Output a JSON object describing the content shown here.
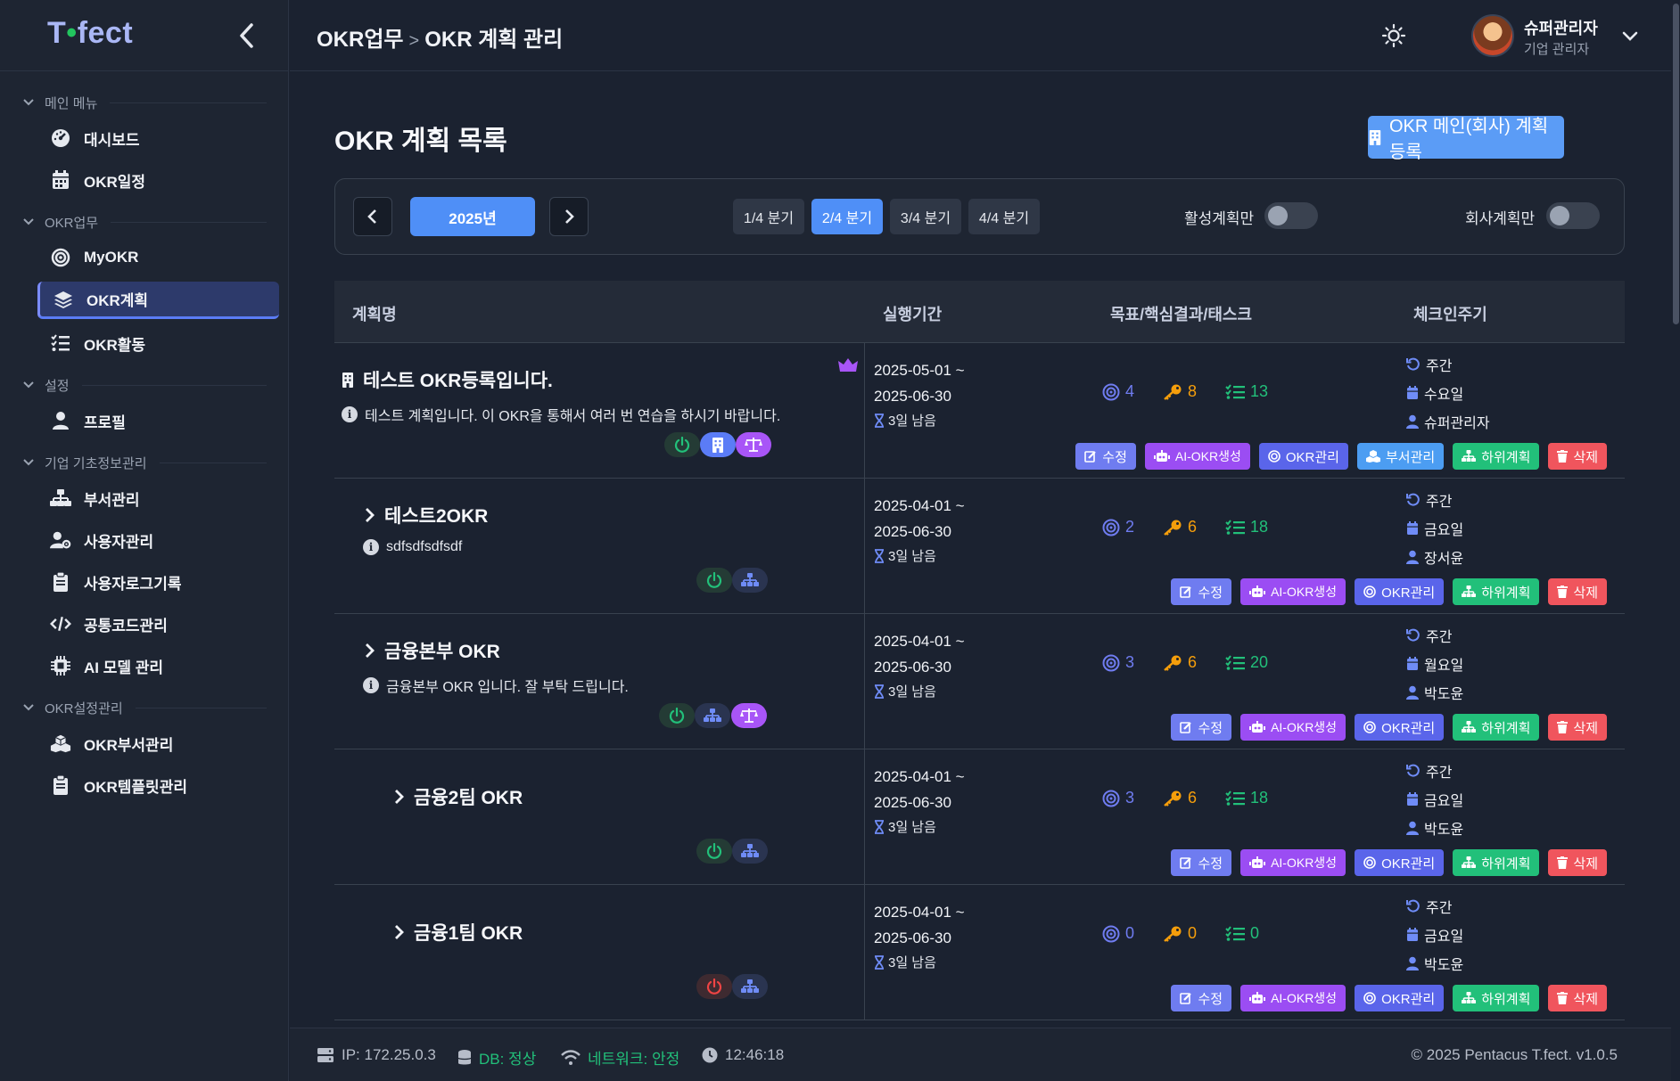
{
  "app": {
    "logo_text_pre": "T",
    "logo_text_post": "fect"
  },
  "sidebar": {
    "sections": [
      {
        "label": "메인 메뉴",
        "items": [
          {
            "label": "대시보드",
            "icon": "gauge-icon"
          },
          {
            "label": "OKR일정",
            "icon": "calendar-icon"
          }
        ]
      },
      {
        "label": "OKR업무",
        "items": [
          {
            "label": "MyOKR",
            "icon": "target-icon"
          },
          {
            "label": "OKR계획",
            "icon": "layers-icon",
            "active": true
          },
          {
            "label": "OKR활동",
            "icon": "list-check-icon"
          }
        ]
      },
      {
        "label": "설정",
        "items": [
          {
            "label": "프로필",
            "icon": "user-icon"
          }
        ]
      },
      {
        "label": "기업 기초정보관리",
        "items": [
          {
            "label": "부서관리",
            "icon": "sitemap-icon"
          },
          {
            "label": "사용자관리",
            "icon": "user-gear-icon"
          },
          {
            "label": "사용자로그기록",
            "icon": "clipboard-icon"
          },
          {
            "label": "공통코드관리",
            "icon": "code-icon"
          },
          {
            "label": "AI 모델 관리",
            "icon": "chip-icon"
          }
        ]
      },
      {
        "label": "OKR설정관리",
        "items": [
          {
            "label": "OKR부서관리",
            "icon": "cubes-icon"
          },
          {
            "label": "OKR템플릿관리",
            "icon": "clipboard-icon"
          }
        ]
      }
    ]
  },
  "header": {
    "breadcrumb_parent": "OKR업무",
    "breadcrumb_sep": ">",
    "breadcrumb_current": "OKR 계획 관리",
    "user_name": "슈퍼관리자",
    "user_role": "기업 관리자"
  },
  "page": {
    "title": "OKR 계획 목록",
    "register_button": "OKR 메인(회사) 계획 등록"
  },
  "filter": {
    "year": "2025년",
    "quarters": [
      "1/4 분기",
      "2/4 분기",
      "3/4 분기",
      "4/4 분기"
    ],
    "active_quarter": "2/4 분기",
    "toggle_active_label": "활성계획만",
    "toggle_company_label": "회사계획만"
  },
  "table": {
    "headers": [
      "계획명",
      "실행기간",
      "목표/핵심결과/태스크",
      "체크인주기"
    ],
    "action_labels": {
      "edit": "수정",
      "ai": "AI-OKR생성",
      "okr": "OKR관리",
      "dept": "부서관리",
      "sub": "하위계획",
      "del": "삭제"
    },
    "rows": [
      {
        "name": "테스트 OKR등록입니다.",
        "desc": "테스트 계획입니다. 이 OKR을 통해서 여러 번 연습을 하시기 바랍니다.",
        "start": "2025-05-01 ~",
        "end": "2025-06-30",
        "remain": "3일 남음",
        "objectives": "4",
        "key_results": "8",
        "tasks": "13",
        "cycle": "주간",
        "day": "수요일",
        "owner": "슈퍼관리자"
      },
      {
        "name": "테스트2OKR",
        "desc": "sdfsdfsdfsdf",
        "start": "2025-04-01 ~",
        "end": "2025-06-30",
        "remain": "3일 남음",
        "objectives": "2",
        "key_results": "6",
        "tasks": "18",
        "cycle": "주간",
        "day": "금요일",
        "owner": "장서윤"
      },
      {
        "name": "금융본부 OKR",
        "desc": "금융본부 OKR 입니다. 잘 부탁 드립니다.",
        "start": "2025-04-01 ~",
        "end": "2025-06-30",
        "remain": "3일 남음",
        "objectives": "3",
        "key_results": "6",
        "tasks": "20",
        "cycle": "주간",
        "day": "월요일",
        "owner": "박도윤"
      },
      {
        "name": "금융2팀 OKR",
        "desc": "",
        "start": "2025-04-01 ~",
        "end": "2025-06-30",
        "remain": "3일 남음",
        "objectives": "3",
        "key_results": "6",
        "tasks": "18",
        "cycle": "주간",
        "day": "금요일",
        "owner": "박도윤"
      },
      {
        "name": "금융1팀 OKR",
        "desc": "",
        "start": "2025-04-01 ~",
        "end": "2025-06-30",
        "remain": "3일 남음",
        "objectives": "0",
        "key_results": "0",
        "tasks": "0",
        "cycle": "주간",
        "day": "금요일",
        "owner": "박도윤"
      }
    ]
  },
  "footer": {
    "ip": "IP: 172.25.0.3",
    "db": "DB: 정상",
    "network": "네트워크: 안정",
    "time": "12:46:18",
    "copyright": "© 2025 Pentacus T.fect. v1.0.5"
  },
  "colors": {
    "accent": "#5b9cf6",
    "objective": "#6f7cf0",
    "key_result": "#f59e0b",
    "task": "#22c07a",
    "status_ok": "#22c07a"
  }
}
